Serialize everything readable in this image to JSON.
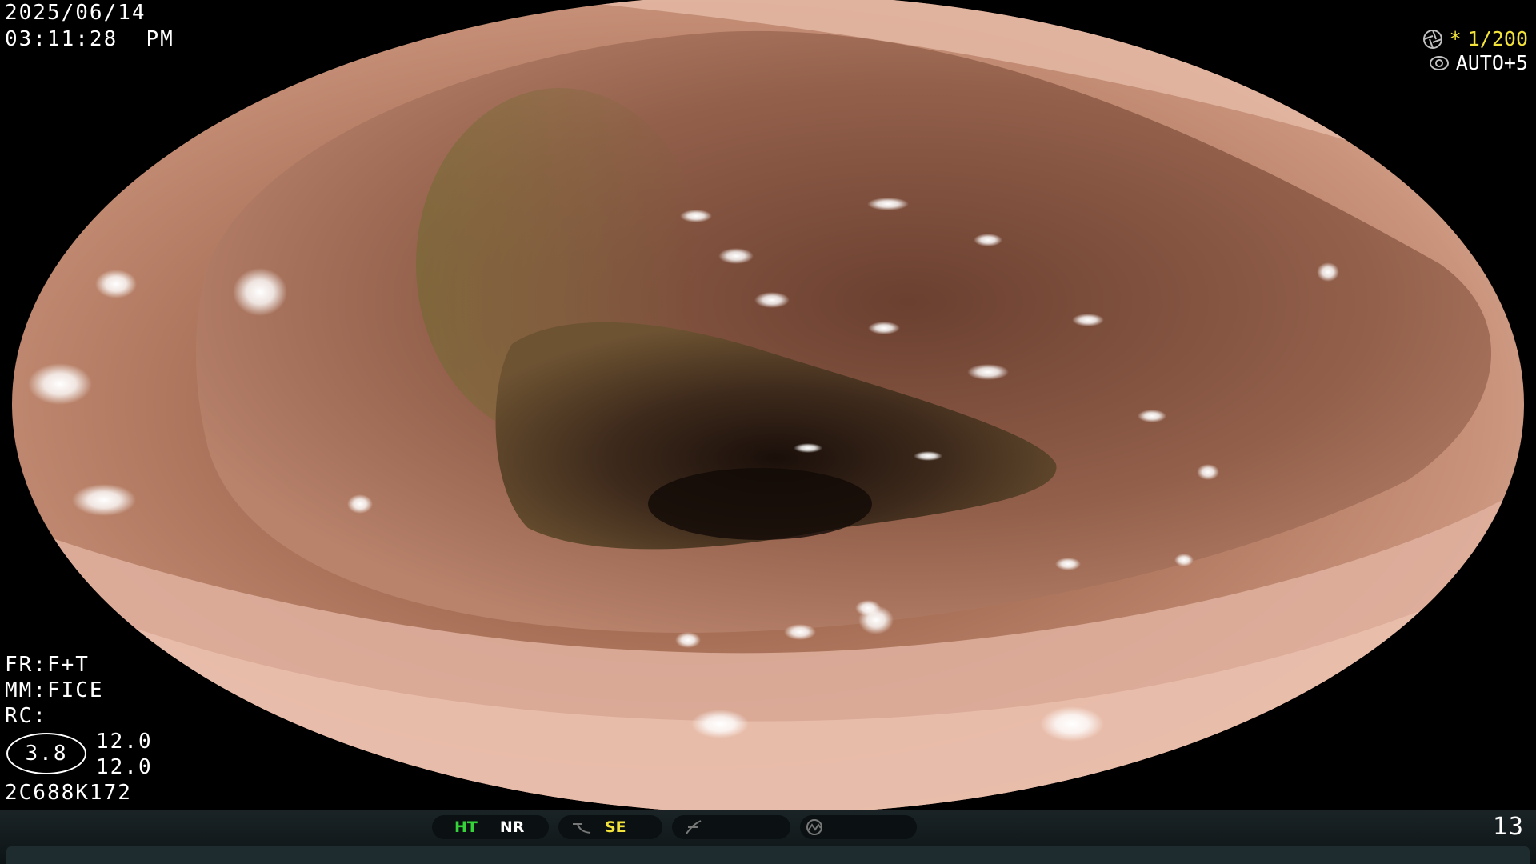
{
  "header": {
    "date": "2025/06/14",
    "time": "03:11:28  PM"
  },
  "top_right": {
    "shutter": "1/200",
    "shutter_prefix": "*",
    "exposure": "AUTO+5",
    "shutter_icon": "aperture-icon",
    "exposure_icon": "iris-icon"
  },
  "left_params": {
    "fr": "FR:F+T",
    "mm": "MM:FICE",
    "rc": "RC:",
    "oval_value": "3.8",
    "val1": "12.0",
    "val2": "12.0",
    "serial": "2C688K172"
  },
  "status_bar": {
    "ht_label": "HT",
    "nr_label": "NR",
    "se_label": "SE",
    "frame_number": "13",
    "icons": [
      "gamma-curve-icon",
      "slash-curve-icon",
      "waveform-icon"
    ]
  },
  "colors": {
    "ht_color": "#35d23a",
    "se_color": "#f2e23a",
    "shutter_prefix_color": "#f2e23a",
    "bar_bg": "#0f1719"
  }
}
